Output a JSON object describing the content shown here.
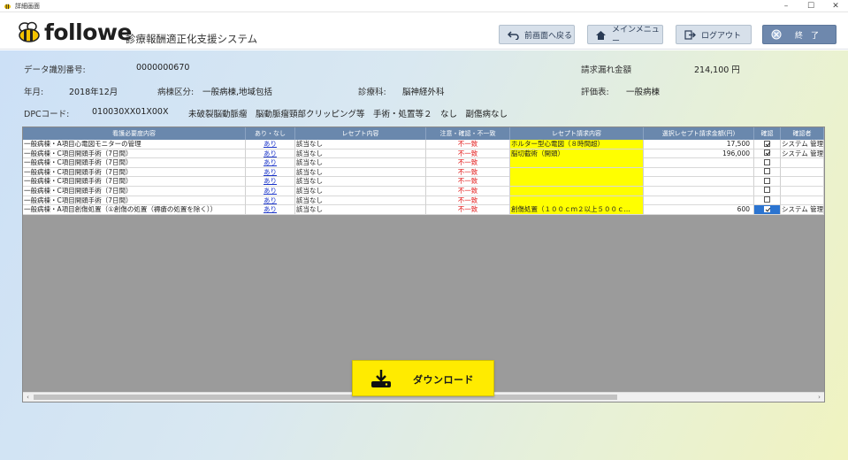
{
  "window": {
    "title": "詳細画面",
    "minimize": "–",
    "maximize": "☐",
    "close": "✕"
  },
  "header": {
    "logo": "followe",
    "subtitle": "診療報酬適正化支援システム",
    "buttons": {
      "back": "前画面へ戻る",
      "menu": "メインメニュー",
      "logout": "ログアウト",
      "end": "終　了"
    }
  },
  "info": {
    "data_id_label": "データ識別番号:",
    "data_id": "0000000670",
    "year_month_label": "年月:",
    "year_month": "2018年12月",
    "ward_label": "病棟区分:",
    "ward": "一般病棟,地域包括",
    "dept_label": "診療科:",
    "dept": "脳神経外科",
    "missed_label": "請求漏れ金額",
    "missed_amount": "214,100 円",
    "eval_label": "評価表:",
    "eval": "一般病棟",
    "dpc_label": "DPCコード:",
    "dpc_code": "010030XX01X00X",
    "dpc_desc": "未破裂脳動脈瘤　脳動脈瘤頸部クリッピング等　手術・処置等２　なし　副傷病なし"
  },
  "grid": {
    "headers": [
      "看護必要度内容",
      "あり・なし",
      "レセプト内容",
      "注意・確認・不一致",
      "レセプト請求内容",
      "選択レセプト請求金額(円)",
      "確認",
      "確認者"
    ],
    "rows": [
      {
        "item": "一般病棟・A項目心電図モニターの管理",
        "flag": "あり",
        "receipt": "該当なし",
        "status": "不一致",
        "claim": "ホルター型心電図（８時間超）",
        "amount": "17,500",
        "checked": true,
        "confirmer": "システム 管理"
      },
      {
        "item": "一般病棟・C項目開頭手術（7日間）",
        "flag": "あり",
        "receipt": "該当なし",
        "status": "不一致",
        "claim": "脳切截術（開頭）",
        "amount": "196,000",
        "checked": true,
        "confirmer": "システム 管理"
      },
      {
        "item": "一般病棟・C項目開頭手術（7日間）",
        "flag": "あり",
        "receipt": "該当なし",
        "status": "不一致",
        "claim": "",
        "amount": "",
        "checked": false,
        "confirmer": ""
      },
      {
        "item": "一般病棟・C項目開頭手術（7日間）",
        "flag": "あり",
        "receipt": "該当なし",
        "status": "不一致",
        "claim": "",
        "amount": "",
        "checked": false,
        "confirmer": ""
      },
      {
        "item": "一般病棟・C項目開頭手術（7日間）",
        "flag": "あり",
        "receipt": "該当なし",
        "status": "不一致",
        "claim": "",
        "amount": "",
        "checked": false,
        "confirmer": ""
      },
      {
        "item": "一般病棟・C項目開頭手術（7日間）",
        "flag": "あり",
        "receipt": "該当なし",
        "status": "不一致",
        "claim": "",
        "amount": "",
        "checked": false,
        "confirmer": ""
      },
      {
        "item": "一般病棟・C項目開頭手術（7日間）",
        "flag": "あり",
        "receipt": "該当なし",
        "status": "不一致",
        "claim": "",
        "amount": "",
        "checked": false,
        "confirmer": ""
      },
      {
        "item": "一般病棟・A項目創傷処置（①創傷の処置（褥瘡の処置を除く））",
        "flag": "あり",
        "receipt": "該当なし",
        "status": "不一致",
        "claim": "創傷処置（１００ｃｍ２以上５００ｃ...",
        "amount": "600",
        "checked": true,
        "confirmer": "システム 管理"
      }
    ]
  },
  "download": {
    "label": "ダウンロード"
  },
  "colors": {
    "header_blue": "#6a88ad",
    "accent_yellow": "#ffeb00",
    "mismatch_red": "#e21b1b",
    "link_blue": "#1a34c9"
  }
}
